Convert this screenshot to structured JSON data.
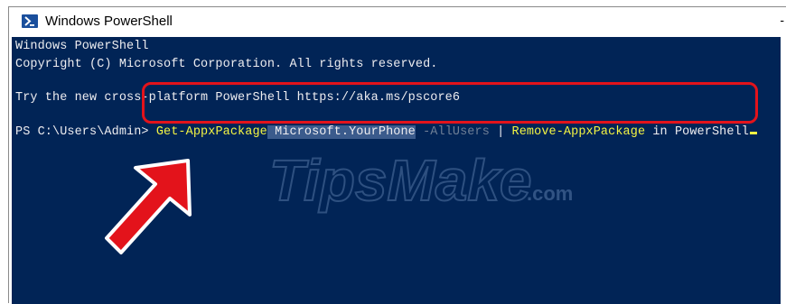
{
  "window": {
    "title": "Windows PowerShell",
    "control_glyph": "-"
  },
  "console": {
    "line1": "Windows PowerShell",
    "line2": "Copyright (C) Microsoft Corporation. All rights reserved.",
    "line3": "Try the new cross-platform PowerShell https://aka.ms/pscore6",
    "prompt": "PS C:\\Users\\Admin> ",
    "cmd_part1": "Get-AppxPackage",
    "cmd_part2": " ",
    "cmd_part3": "Microsoft.YourPhone",
    "cmd_part4": " -AllUsers",
    "cmd_part5": " | ",
    "cmd_part6": "Remove-AppxPackage",
    "cmd_part7": " in PowerShell"
  },
  "watermark": {
    "text": "TipsMake",
    "suffix": ".com"
  },
  "colors": {
    "console_bg": "#012456",
    "highlight": "#e3131b",
    "command": "#f5f543"
  }
}
